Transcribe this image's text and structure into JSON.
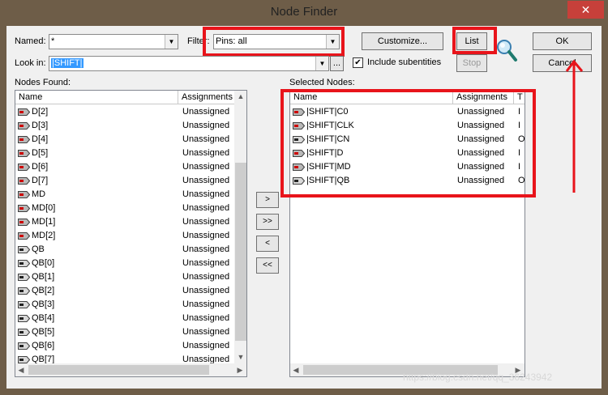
{
  "window": {
    "title": "Node Finder",
    "close_glyph": "✕"
  },
  "named": {
    "label": "Named:",
    "value": "*"
  },
  "filter": {
    "label": "Filter:",
    "value": "Pins: all"
  },
  "look_in": {
    "label": "Look in:",
    "value": "|SHIFT|",
    "browse_label": "..."
  },
  "buttons": {
    "customize": "Customize...",
    "list": "List",
    "stop": "Stop",
    "ok": "OK",
    "cancel": "Cancel",
    "move_right": ">",
    "move_all_right": ">>",
    "move_left": "<",
    "move_all_left": "<<"
  },
  "include_subentities": {
    "label": "Include subentities",
    "checked": true,
    "check_glyph": "✔"
  },
  "nodes_found": {
    "label": "Nodes Found:",
    "columns": [
      "Name",
      "Assignments"
    ],
    "rows": [
      {
        "name": "D[2]",
        "assignment": "Unassigned",
        "icon": "input-pin-icon"
      },
      {
        "name": "D[3]",
        "assignment": "Unassigned",
        "icon": "input-pin-icon"
      },
      {
        "name": "D[4]",
        "assignment": "Unassigned",
        "icon": "input-pin-icon"
      },
      {
        "name": "D[5]",
        "assignment": "Unassigned",
        "icon": "input-pin-icon"
      },
      {
        "name": "D[6]",
        "assignment": "Unassigned",
        "icon": "input-pin-icon"
      },
      {
        "name": "D[7]",
        "assignment": "Unassigned",
        "icon": "input-pin-icon"
      },
      {
        "name": "MD",
        "assignment": "Unassigned",
        "icon": "input-pin-icon"
      },
      {
        "name": "MD[0]",
        "assignment": "Unassigned",
        "icon": "input-pin-icon"
      },
      {
        "name": "MD[1]",
        "assignment": "Unassigned",
        "icon": "input-pin-icon"
      },
      {
        "name": "MD[2]",
        "assignment": "Unassigned",
        "icon": "input-pin-icon"
      },
      {
        "name": "QB",
        "assignment": "Unassigned",
        "icon": "output-pin-icon"
      },
      {
        "name": "QB[0]",
        "assignment": "Unassigned",
        "icon": "output-pin-icon"
      },
      {
        "name": "QB[1]",
        "assignment": "Unassigned",
        "icon": "output-pin-icon"
      },
      {
        "name": "QB[2]",
        "assignment": "Unassigned",
        "icon": "output-pin-icon"
      },
      {
        "name": "QB[3]",
        "assignment": "Unassigned",
        "icon": "output-pin-icon"
      },
      {
        "name": "QB[4]",
        "assignment": "Unassigned",
        "icon": "output-pin-icon"
      },
      {
        "name": "QB[5]",
        "assignment": "Unassigned",
        "icon": "output-pin-icon"
      },
      {
        "name": "QB[6]",
        "assignment": "Unassigned",
        "icon": "output-pin-icon"
      },
      {
        "name": "QB[7]",
        "assignment": "Unassigned",
        "icon": "output-pin-icon"
      }
    ]
  },
  "selected_nodes": {
    "label": "Selected Nodes:",
    "columns": [
      "Name",
      "Assignments",
      "T"
    ],
    "rows": [
      {
        "name": "|SHIFT|C0",
        "assignment": "Unassigned",
        "extra": "I",
        "icon": "input-pin-icon"
      },
      {
        "name": "|SHIFT|CLK",
        "assignment": "Unassigned",
        "extra": "I",
        "icon": "input-pin-icon"
      },
      {
        "name": "|SHIFT|CN",
        "assignment": "Unassigned",
        "extra": "O",
        "icon": "output-pin-icon"
      },
      {
        "name": "|SHIFT|D",
        "assignment": "Unassigned",
        "extra": "I",
        "icon": "input-pin-icon"
      },
      {
        "name": "|SHIFT|MD",
        "assignment": "Unassigned",
        "extra": "I",
        "icon": "input-pin-icon"
      },
      {
        "name": "|SHIFT|QB",
        "assignment": "Unassigned",
        "extra": "O",
        "icon": "output-pin-icon"
      }
    ]
  },
  "watermark": "https://blog.csdn.net/qq_36243942",
  "colors": {
    "highlight": "#e8141b",
    "selection": "#3399ff",
    "titlebar": "#6e5d48",
    "close": "#c7403a"
  }
}
